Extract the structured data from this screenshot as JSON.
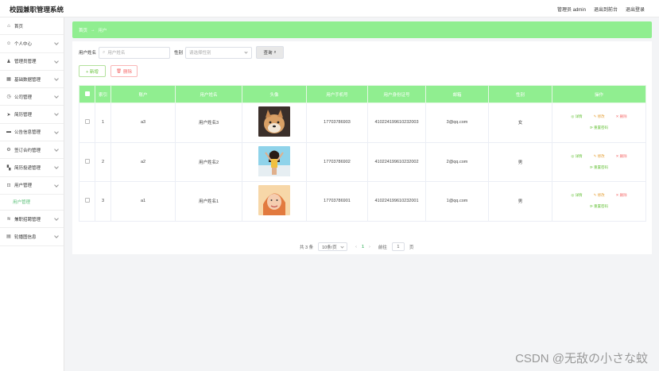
{
  "header": {
    "title": "校园兼职管理系统",
    "admin": "管理员 admin",
    "back_home": "退出到前台",
    "logout": "退出登录"
  },
  "sidebar": {
    "items": [
      {
        "icon": "home-icon",
        "glyph": "⌂",
        "label": "首页",
        "chevron": false
      },
      {
        "icon": "user-icon",
        "glyph": "☺",
        "label": "个人中心",
        "chevron": true
      },
      {
        "icon": "admin-icon",
        "glyph": "♟",
        "label": "管理员管理",
        "chevron": true
      },
      {
        "icon": "database-icon",
        "glyph": "▦",
        "label": "基础数据管理",
        "chevron": true
      },
      {
        "icon": "company-icon",
        "glyph": "◷",
        "label": "公司管理",
        "chevron": true
      },
      {
        "icon": "send-icon",
        "glyph": "➤",
        "label": "简历管理",
        "chevron": true
      },
      {
        "icon": "notice-icon",
        "glyph": "▬",
        "label": "公告信息管理",
        "chevron": true
      },
      {
        "icon": "contract-icon",
        "glyph": "⚙",
        "label": "签订合约管理",
        "chevron": true
      },
      {
        "icon": "grid-icon",
        "glyph": "▚",
        "label": "简历投递管理",
        "chevron": true
      },
      {
        "icon": "lock-icon",
        "glyph": "⊡",
        "label": "用户管理",
        "chevron": true,
        "sub": "用户管理"
      },
      {
        "icon": "recruit-icon",
        "glyph": "≋",
        "label": "兼职招聘管理",
        "chevron": true
      },
      {
        "icon": "carousel-icon",
        "glyph": "▤",
        "label": "轮播图信息",
        "chevron": true
      }
    ]
  },
  "breadcrumb": {
    "home": "首页",
    "sep": "→",
    "current": "用户"
  },
  "search": {
    "name_label": "用户姓名",
    "name_placeholder": "用户姓名",
    "gender_label": "性别",
    "gender_placeholder": "请选择性别",
    "button": "查询"
  },
  "actions": {
    "add": "+ 新增",
    "delete": "删除"
  },
  "table": {
    "columns": [
      "",
      "索引",
      "账户",
      "用户姓名",
      "头像",
      "用户手机号",
      "用户身份证号",
      "邮箱",
      "性别",
      "操作"
    ],
    "rows": [
      {
        "index": "1",
        "account": "a3",
        "name": "用户姓名3",
        "phone": "17703786903",
        "idcard": "410224199610232003",
        "email": "3@qq.com",
        "gender": "女",
        "avatar": "dog"
      },
      {
        "index": "2",
        "account": "a2",
        "name": "用户姓名2",
        "phone": "17703786902",
        "idcard": "410224199610232002",
        "email": "2@qq.com",
        "gender": "男",
        "avatar": "woman"
      },
      {
        "index": "3",
        "account": "a1",
        "name": "用户姓名1",
        "phone": "17703786901",
        "idcard": "410224199610232001",
        "email": "1@qq.com",
        "gender": "男",
        "avatar": "girl"
      }
    ],
    "ops": {
      "detail": "详情",
      "edit": "修改",
      "remove": "删除",
      "reset": "重置密码"
    }
  },
  "pager": {
    "total": "共 3 条",
    "page_size": "10条/页",
    "prev": "‹",
    "current": "1",
    "next": "›",
    "goto": "前往",
    "goto_value": "1",
    "unit": "页"
  },
  "watermark": "CSDN @无敌の小さな蚊",
  "colors": {
    "accent": "#90ee90",
    "sub_active": "#5cc07a",
    "danger": "#f56c6c",
    "warning": "#e6a23c",
    "success": "#67c23a"
  }
}
